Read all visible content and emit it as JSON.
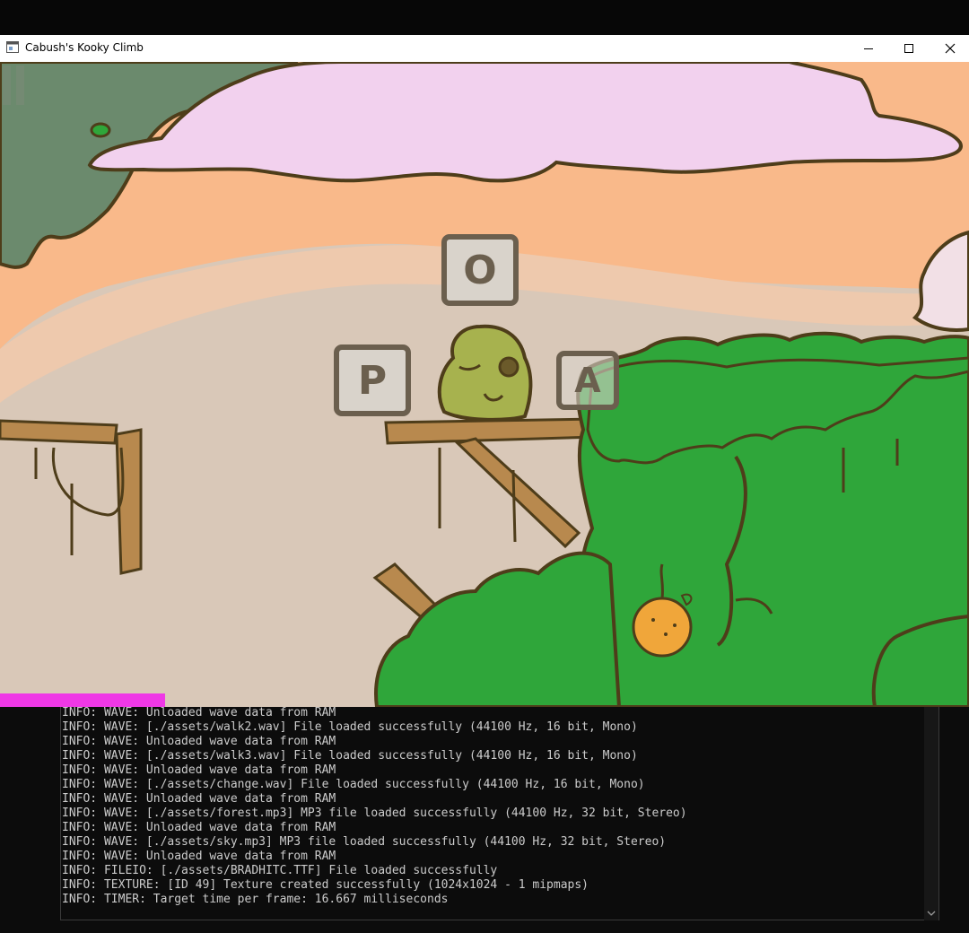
{
  "window": {
    "title": "Cabush's Kooky Climb",
    "controls": {
      "minimize": "minimize",
      "maximize": "maximize",
      "close": "close"
    }
  },
  "game": {
    "tiles": [
      {
        "letter": "O",
        "name": "letter-tile-o"
      },
      {
        "letter": "P",
        "name": "letter-tile-p"
      },
      {
        "letter": "A",
        "name": "letter-tile-a"
      }
    ],
    "progress": 0.17,
    "colors": {
      "sky": "#f9b98a",
      "cloud": "#f2d1ee",
      "bush": "#2fa63a",
      "outline": "#4e3d1a",
      "progress": "#ef38e6"
    }
  },
  "console": {
    "lines": [
      "INFO: WAVE: Unloaded wave data from RAM",
      "INFO: WAVE: [./assets/walk2.wav] File loaded successfully (44100 Hz, 16 bit, Mono)",
      "INFO: WAVE: Unloaded wave data from RAM",
      "INFO: WAVE: [./assets/walk3.wav] File loaded successfully (44100 Hz, 16 bit, Mono)",
      "INFO: WAVE: Unloaded wave data from RAM",
      "INFO: WAVE: [./assets/change.wav] File loaded successfully (44100 Hz, 16 bit, Mono)",
      "INFO: WAVE: Unloaded wave data from RAM",
      "INFO: WAVE: [./assets/forest.mp3] MP3 file loaded successfully (44100 Hz, 32 bit, Stereo)",
      "INFO: WAVE: Unloaded wave data from RAM",
      "INFO: WAVE: [./assets/sky.mp3] MP3 file loaded successfully (44100 Hz, 32 bit, Stereo)",
      "INFO: WAVE: Unloaded wave data from RAM",
      "INFO: FILEIO: [./assets/BRADHITC.TTF] File loaded successfully",
      "INFO: TEXTURE: [ID 49] Texture created successfully (1024x1024 - 1 mipmaps)",
      "INFO: TIMER: Target time per frame: 16.667 milliseconds"
    ]
  }
}
